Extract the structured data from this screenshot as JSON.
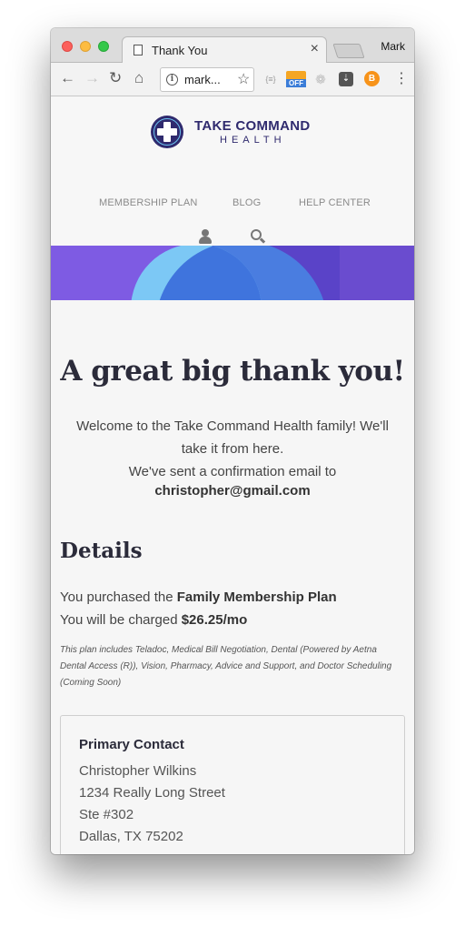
{
  "browser": {
    "tab_title": "Thank You",
    "tab_close": "×",
    "profile_name": "Mark",
    "url": "mark...",
    "ext_off_label": "OFF",
    "ext_b_label": "B"
  },
  "site": {
    "logo_title": "TAKE COMMAND",
    "logo_subtitle": "HEALTH",
    "nav": [
      "MEMBERSHIP PLAN",
      "BLOG",
      "HELP CENTER"
    ],
    "brand_color": "#2f2a6e",
    "banner_color": "#7e5be3"
  },
  "thankyou": {
    "title": "A great big thank you!",
    "welcome": "Welcome to the Take Command Health family! We'll take it from here.",
    "sent": "We've sent a confirmation email to",
    "email": "christopher@gmail.com"
  },
  "details": {
    "title": "Details",
    "purchased_prefix": "You purchased the",
    "plan_name": "Family Membership Plan",
    "charged_prefix": "You will be charged",
    "price": "$26.25/mo",
    "fine_print": "This plan includes Teladoc, Medical Bill Negotiation, Dental (Powered by Aetna Dental Access (R)), Vision, Pharmacy, Advice and Support, and Doctor Scheduling (Coming Soon)"
  },
  "contact": {
    "heading": "Primary Contact",
    "name": "Christopher Wilkins",
    "street": "1234 Really Long Street",
    "suite": "Ste #302",
    "city": "Dallas, TX 75202"
  }
}
